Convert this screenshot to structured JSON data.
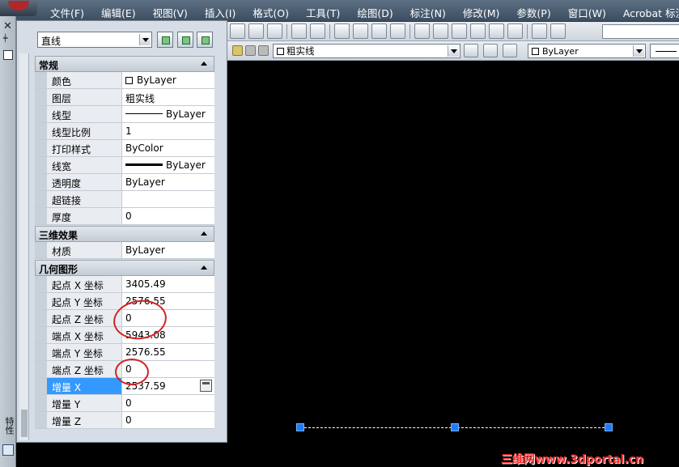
{
  "menu": {
    "items": [
      "文件(F)",
      "编辑(E)",
      "视图(V)",
      "插入(I)",
      "格式(O)",
      "工具(T)",
      "绘图(D)",
      "标注(N)",
      "修改(M)",
      "参数(P)",
      "窗口(W)",
      "Acrobat 标注"
    ]
  },
  "toolbar": {
    "layer_combo_value": "粗实线",
    "color_combo_value": "ByLayer",
    "icons": [
      "copy-icon",
      "paste-icon",
      "matchprop-icon",
      "undo-icon",
      "redo-icon",
      "pan-icon",
      "zoom-realtime-icon",
      "zoom-window-icon",
      "zoom-previous-icon",
      "properties-icon",
      "design-center-icon",
      "tool-palettes-icon",
      "sheet-set-icon",
      "markup-icon",
      "quickcalc-icon",
      "help-icon",
      "text-style-icon"
    ]
  },
  "palette": {
    "object_type": "直线",
    "side_label": "特性",
    "sections": [
      {
        "title": "常规",
        "rows": [
          {
            "label": "颜色",
            "value": "ByLayer",
            "swatch": true
          },
          {
            "label": "图层",
            "value": "粗实线"
          },
          {
            "label": "线型",
            "value": "ByLayer",
            "line": "thin"
          },
          {
            "label": "线型比例",
            "value": "1"
          },
          {
            "label": "打印样式",
            "value": "ByColor"
          },
          {
            "label": "线宽",
            "value": "ByLayer",
            "line": "thick"
          },
          {
            "label": "透明度",
            "value": "ByLayer"
          },
          {
            "label": "超链接",
            "value": ""
          },
          {
            "label": "厚度",
            "value": "0"
          }
        ]
      },
      {
        "title": "三维效果",
        "rows": [
          {
            "label": "材质",
            "value": "ByLayer"
          }
        ]
      },
      {
        "title": "几何图形",
        "rows": [
          {
            "label": "起点 X 坐标",
            "value": "3405.49"
          },
          {
            "label": "起点 Y 坐标",
            "value": "2576.55"
          },
          {
            "label": "起点 Z 坐标",
            "value": "0"
          },
          {
            "label": "端点 X 坐标",
            "value": "5943.08"
          },
          {
            "label": "端点 Y 坐标",
            "value": "2576.55"
          },
          {
            "label": "端点 Z 坐标",
            "value": "0"
          },
          {
            "label": "增量 X",
            "value": "2537.59",
            "selected": true
          },
          {
            "label": "增量 Y",
            "value": "0"
          },
          {
            "label": "增量 Z",
            "value": "0"
          }
        ]
      }
    ]
  },
  "watermark": "三维网www.3dportal.cn"
}
